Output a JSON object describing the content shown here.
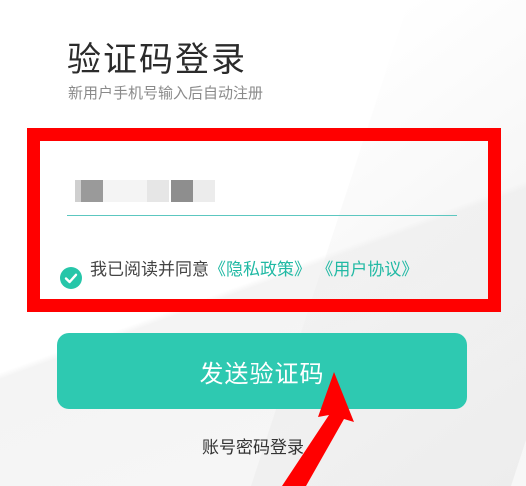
{
  "login": {
    "title": "验证码登录",
    "subtitle": "新用户手机号输入后自动注册",
    "phone_value": "",
    "agreement": {
      "prefix": "我已阅读并同意",
      "privacy_link": "《隐私政策》",
      "user_link": "《用户协议》"
    },
    "send_code_label": "发送验证码",
    "password_login_label": "账号密码登录"
  },
  "colors": {
    "accent": "#2ec9b1",
    "link": "#21b9a4",
    "annotation": "#ff0000"
  },
  "icons": {
    "agree_check": "check-circle-icon",
    "annotation_arrow": "arrow-icon"
  }
}
